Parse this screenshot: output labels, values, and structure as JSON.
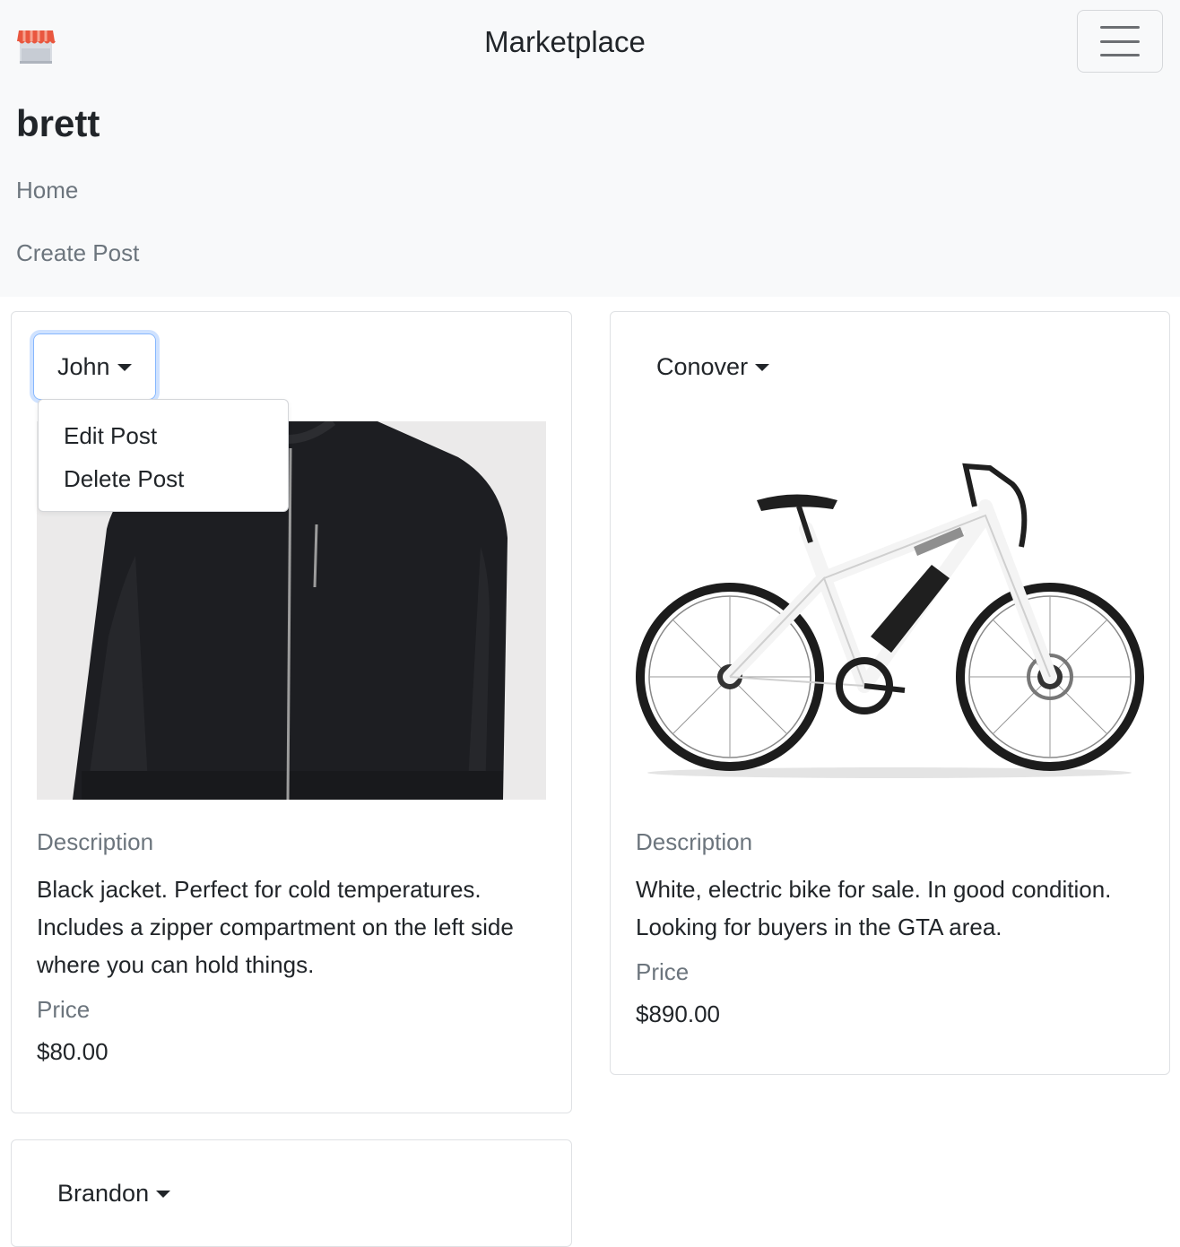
{
  "app": {
    "title": "Marketplace",
    "logo_icon": "storefront-icon",
    "menu_icon": "hamburger-menu-icon"
  },
  "user": {
    "name": "brett"
  },
  "nav": {
    "home": "Home",
    "create_post": "Create Post"
  },
  "posts": [
    {
      "owner": "John",
      "menu_open": true,
      "menu": [
        "Edit Post",
        "Delete Post"
      ],
      "image": "black-jacket-image",
      "description_label": "Description",
      "description": "Black jacket. Perfect for cold temperatures. Includes a zipper compartment on the left side where you can hold things.",
      "price_label": "Price",
      "price": "$80.00"
    },
    {
      "owner": "Conover",
      "menu_open": false,
      "image": "white-electric-bike-image",
      "description_label": "Description",
      "description": "White, electric bike for sale. In good condition. Looking for buyers in the GTA area.",
      "price_label": "Price",
      "price": "$890.00"
    },
    {
      "owner": "Brandon",
      "menu_open": false
    }
  ],
  "colors": {
    "navbar_bg": "#f8f9fa",
    "muted_text": "#6c757d",
    "focus_ring": "#86b7fe"
  }
}
